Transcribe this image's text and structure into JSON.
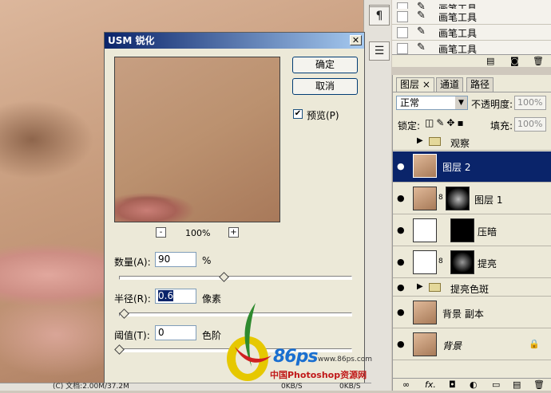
{
  "dialog": {
    "title": "USM 锐化",
    "ok_label": "确定",
    "cancel_label": "取消",
    "preview_label": "预览(P)",
    "preview_checked": true,
    "zoom": "100%",
    "zoom_out": "-",
    "zoom_in": "+",
    "amount": {
      "label": "数量(A):",
      "value": "90",
      "unit": "%",
      "level": 0.45
    },
    "radius": {
      "label": "半径(R):",
      "value": "0.6",
      "unit": "像素",
      "level": 0.02
    },
    "threshold": {
      "label": "阈值(T):",
      "value": "0",
      "unit": "色阶",
      "level": 0.0
    }
  },
  "history": {
    "items": [
      {
        "label": "画笔工具"
      },
      {
        "label": "画笔工具"
      },
      {
        "label": "画笔工具"
      },
      {
        "label": "画笔工具"
      }
    ]
  },
  "layers_panel": {
    "tabs": [
      "图层",
      "通道",
      "路径"
    ],
    "blend_mode": "正常",
    "opacity_label": "不透明度:",
    "opacity": "100%",
    "lock_label": "锁定:",
    "fill_label": "填充:",
    "fill": "100%",
    "layers": [
      {
        "name": "观察",
        "kind": "group"
      },
      {
        "name": "图层 2",
        "kind": "layer",
        "selected": true
      },
      {
        "name": "图层 1",
        "kind": "layer-mask"
      },
      {
        "name": "压暗",
        "kind": "curves"
      },
      {
        "name": "提亮",
        "kind": "curves-mask"
      },
      {
        "name": "提亮色斑",
        "kind": "group"
      },
      {
        "name": "背景 副本",
        "kind": "layer"
      },
      {
        "name": "背景",
        "kind": "background"
      }
    ]
  },
  "watermark": {
    "brand": "86ps",
    "url": "www.86ps.com",
    "text": "中国Photoshop资源网"
  },
  "status": {
    "text": "(C) 文档:2.00M/37.2M",
    "speed1": "0KB/S",
    "speed2": "0KB/S"
  }
}
